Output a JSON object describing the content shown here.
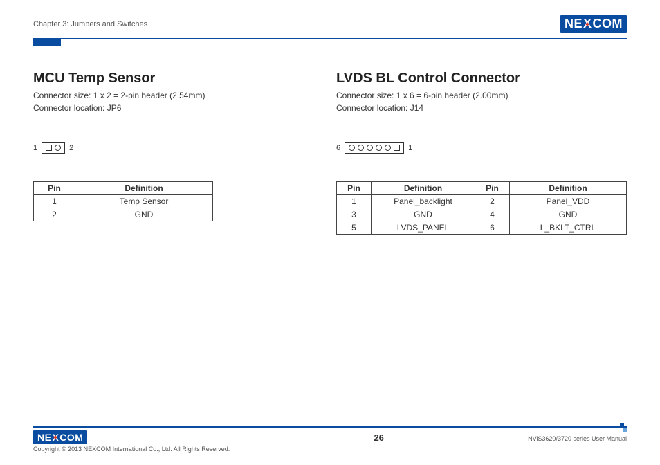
{
  "header": {
    "chapter": "Chapter 3: Jumpers and Switches",
    "logo_left": "NE",
    "logo_x": "X",
    "logo_right": "COM"
  },
  "sections": {
    "left": {
      "title": "MCU Temp Sensor",
      "size": "Connector size: 1 x 2 = 2-pin header (2.54mm)",
      "loc": "Connector location: JP6",
      "pin_left_label": "1",
      "pin_right_label": "2",
      "table": {
        "head": {
          "pin": "Pin",
          "def": "Definition"
        },
        "rows": [
          {
            "pin": "1",
            "def": "Temp Sensor"
          },
          {
            "pin": "2",
            "def": "GND"
          }
        ]
      }
    },
    "right": {
      "title": "LVDS BL Control Connector",
      "size": "Connector size: 1 x 6 = 6-pin header (2.00mm)",
      "loc": "Connector location: J14",
      "pin_left_label": "6",
      "pin_right_label": "1",
      "table": {
        "head": {
          "pinA": "Pin",
          "defA": "Definition",
          "pinB": "Pin",
          "defB": "Definition"
        },
        "rows": [
          {
            "pinA": "1",
            "defA": "Panel_backlight",
            "pinB": "2",
            "defB": "Panel_VDD"
          },
          {
            "pinA": "3",
            "defA": "GND",
            "pinB": "4",
            "defB": "GND"
          },
          {
            "pinA": "5",
            "defA": "LVDS_PANEL",
            "pinB": "6",
            "defB": "L_BKLT_CTRL"
          }
        ]
      }
    }
  },
  "footer": {
    "copyright": "Copyright © 2013 NEXCOM International Co., Ltd. All Rights Reserved.",
    "page": "26",
    "manual": "NViS3620/3720 series User Manual"
  }
}
